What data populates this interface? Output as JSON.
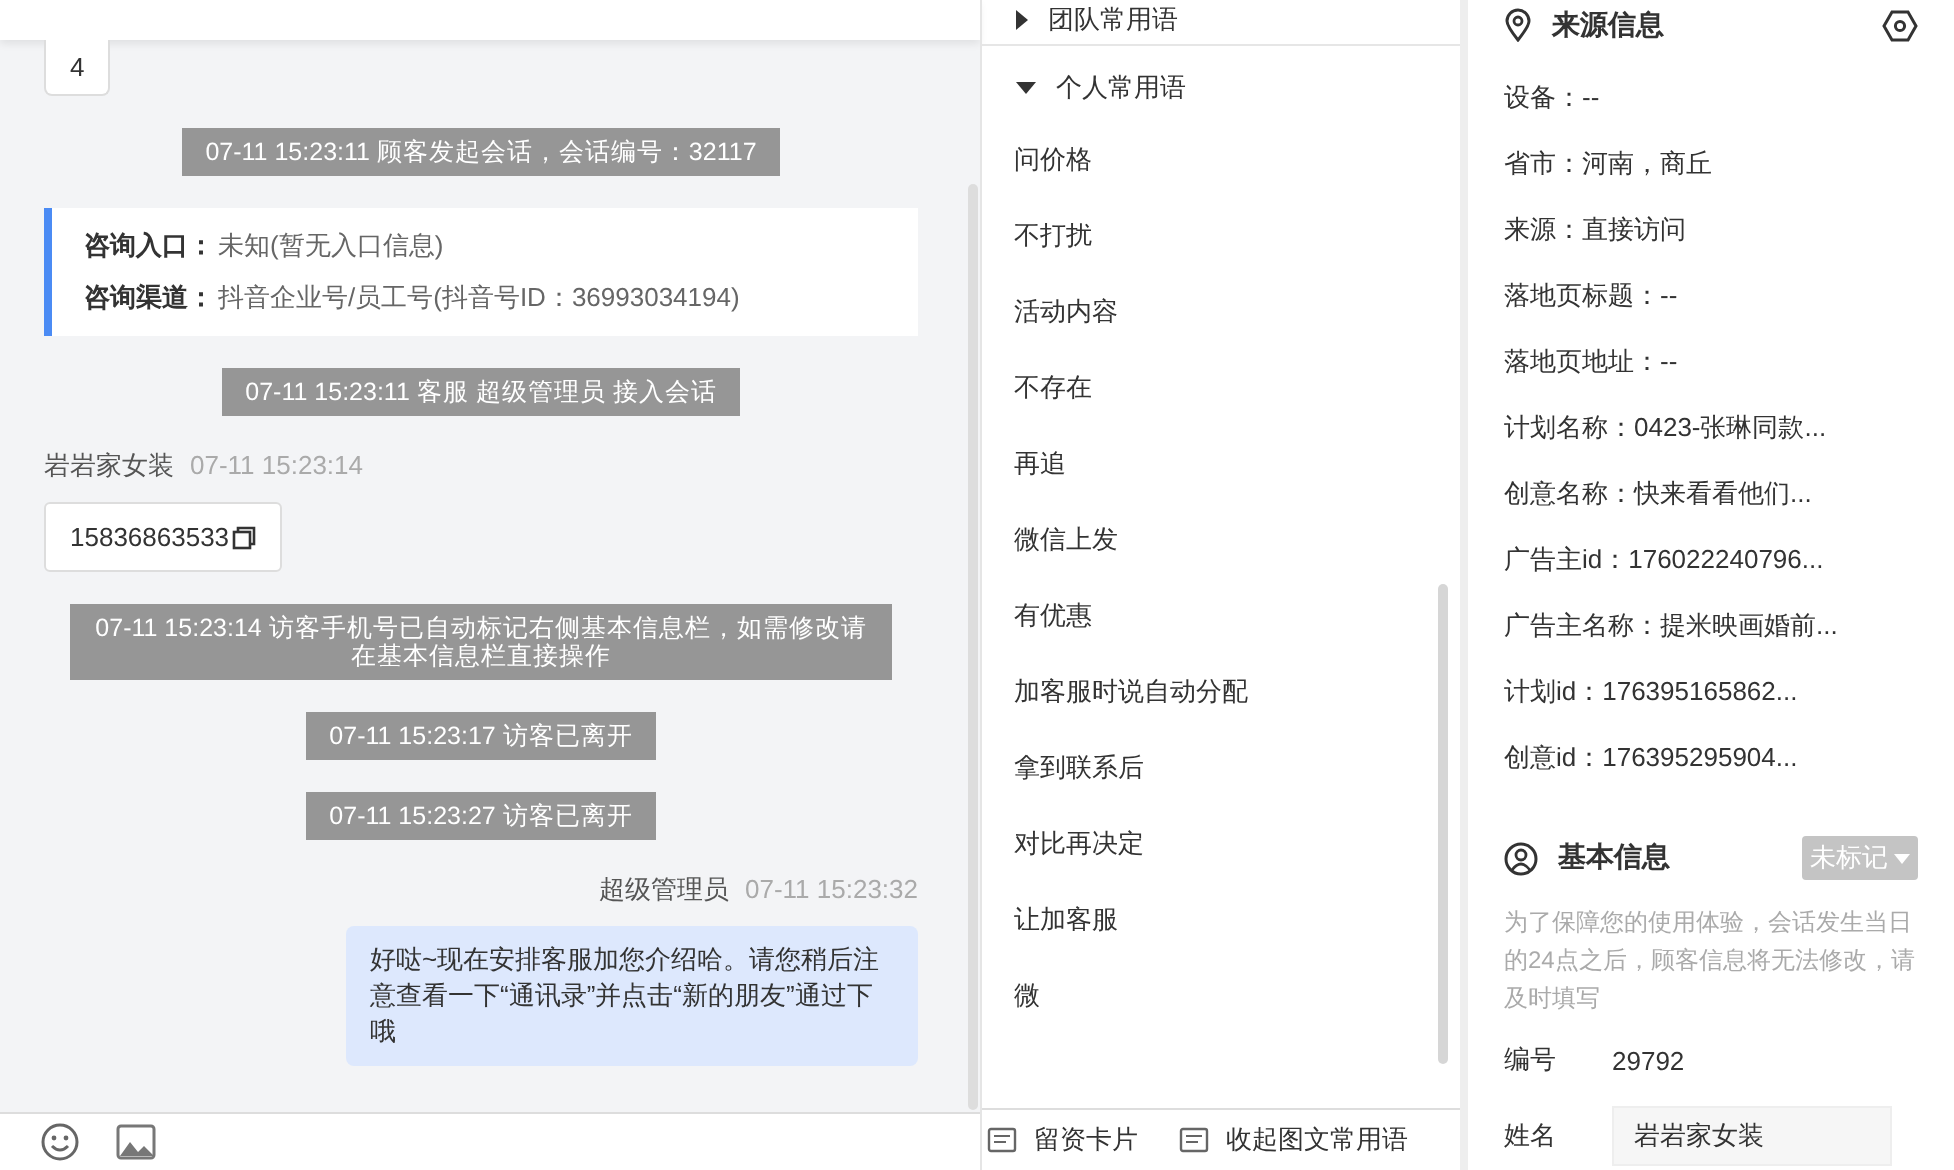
{
  "chat": {
    "messages": [
      {
        "kind": "card",
        "text": "4"
      },
      {
        "kind": "system",
        "text": "07-11 15:23:11 顾客发起会话，会话编号：32117"
      },
      {
        "kind": "info",
        "rows": [
          {
            "label": "咨询入口：",
            "value": "未知(暂无入口信息)"
          },
          {
            "label": "咨询渠道：",
            "value": "抖音企业号/员工号(抖音号ID：36993034194)"
          }
        ]
      },
      {
        "kind": "system",
        "text": "07-11 15:23:11 客服 超级管理员 接入会话"
      },
      {
        "kind": "customer",
        "name": "岩岩家女装",
        "time": "07-11 15:23:14",
        "text": "15836863533"
      },
      {
        "kind": "system",
        "text": "07-11 15:23:14 访客手机号已自动标记右侧基本信息栏，如需修改请在基本信息栏直接操作"
      },
      {
        "kind": "system",
        "text": "07-11 15:23:17 访客已离开"
      },
      {
        "kind": "system",
        "text": "07-11 15:23:27 访客已离开"
      },
      {
        "kind": "agent",
        "name": "超级管理员",
        "time": "07-11 15:23:32",
        "text": "好哒~现在安排客服加您介绍哈。请您稍后注意查看一下“通讯录”并点击“新的朋友”通过下哦"
      }
    ]
  },
  "phrases": {
    "groups": [
      {
        "title": "团队常用语",
        "expanded": false
      },
      {
        "title": "个人常用语",
        "expanded": true,
        "items": [
          "问价格",
          "不打扰",
          "活动内容",
          "不存在",
          "再追",
          "微信上发",
          "有优惠",
          "加客服时说自动分配",
          "拿到联系后",
          "对比再决定",
          "让加客服",
          "微"
        ]
      }
    ],
    "footer": [
      "留资卡片",
      "收起图文常用语"
    ]
  },
  "source": {
    "title": "来源信息",
    "rows": [
      "设备：--",
      "省市：河南，商丘",
      "来源：直接访问",
      "落地页标题：--",
      "落地页地址：--",
      "计划名称：0423-张琳同款...",
      "创意名称：快来看看他们...",
      "广告主id：176022240796...",
      "广告主名称：提米映画婚前...",
      "计划id：176395165862...",
      "创意id：176395295904..."
    ]
  },
  "basic": {
    "title": "基本信息",
    "tag": "未标记",
    "notice": "为了保障您的使用体验，会话发生当日的24点之后，顾客信息将无法修改，请及时填写",
    "fields": [
      {
        "kind": "text",
        "label": "编号",
        "value": "29792"
      },
      {
        "kind": "input",
        "label": "姓名",
        "value": "岩岩家女装"
      }
    ]
  }
}
